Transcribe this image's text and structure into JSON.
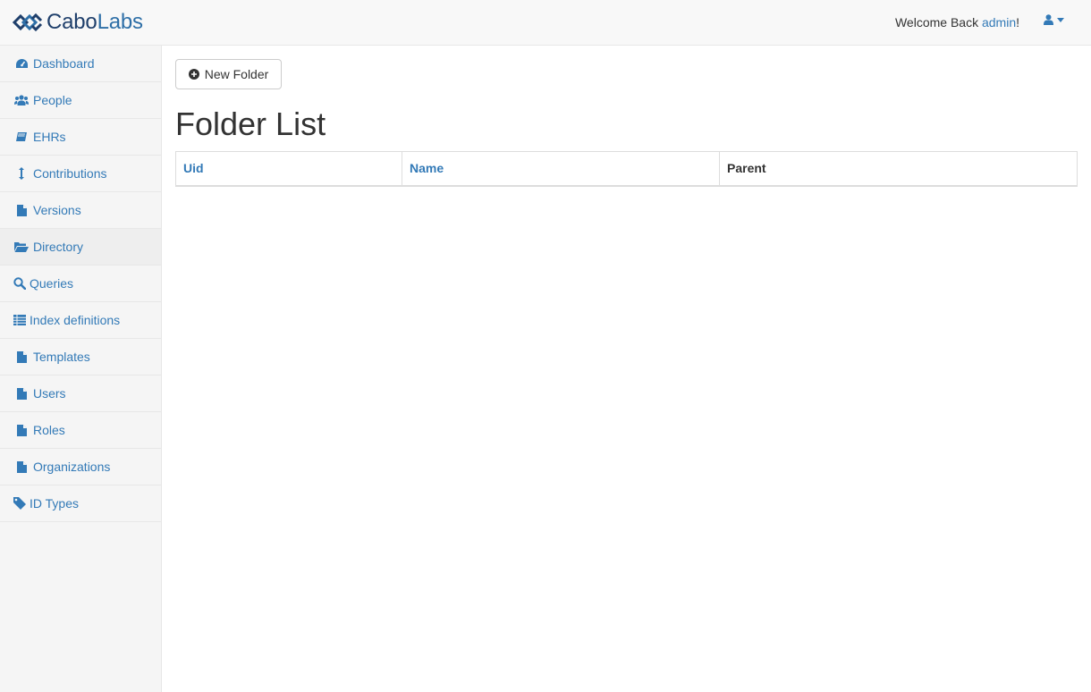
{
  "brand": {
    "part1": "Cabo",
    "part2": "Labs"
  },
  "header": {
    "welcome_prefix": "Welcome Back ",
    "username": "admin",
    "welcome_suffix": "!",
    "accent": "#337ab7"
  },
  "sidebar": {
    "items": [
      {
        "label": "Dashboard",
        "icon": "dashboard-icon"
      },
      {
        "label": "People",
        "icon": "users-icon"
      },
      {
        "label": "EHRs",
        "icon": "book-icon"
      },
      {
        "label": "Contributions",
        "icon": "resize-vertical-icon"
      },
      {
        "label": "Versions",
        "icon": "file-icon"
      },
      {
        "label": "Directory",
        "icon": "folder-open-icon",
        "active": true
      },
      {
        "label": "Queries",
        "icon": "search-icon"
      },
      {
        "label": "Index definitions",
        "icon": "table-icon"
      },
      {
        "label": "Templates",
        "icon": "file-icon"
      },
      {
        "label": "Users",
        "icon": "file-icon"
      },
      {
        "label": "Roles",
        "icon": "file-icon"
      },
      {
        "label": "Organizations",
        "icon": "file-icon"
      },
      {
        "label": "ID Types",
        "icon": "tag-icon"
      }
    ]
  },
  "main": {
    "new_button": "New Folder",
    "title": "Folder List",
    "table": {
      "columns": [
        "Uid",
        "Name",
        "Parent"
      ],
      "rows": []
    }
  }
}
